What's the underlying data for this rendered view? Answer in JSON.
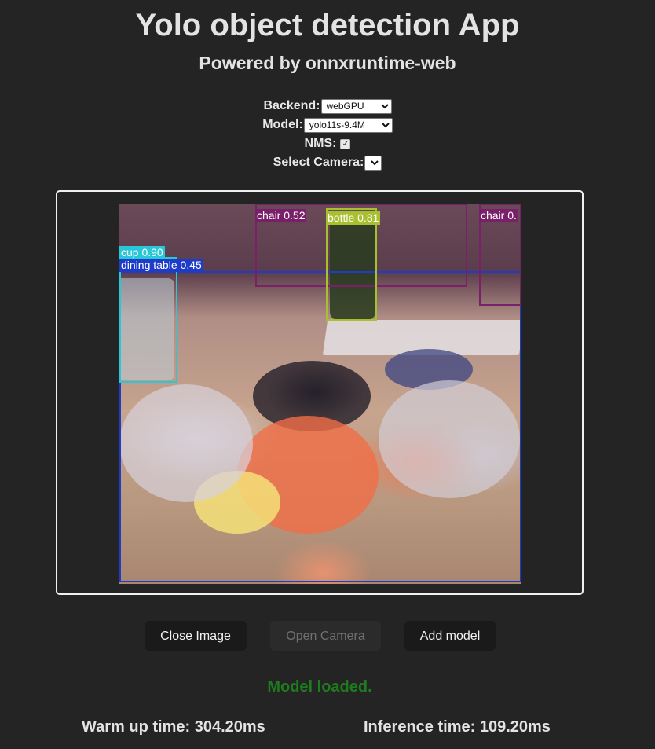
{
  "header": {
    "title": "Yolo object detection App",
    "subtitle": "Powered by onnxruntime-web"
  },
  "controls": {
    "backend_label": "Backend:",
    "backend_value": "webGPU",
    "model_label": "Model:",
    "model_value": "yolo11s-9.4M",
    "nms_label": "NMS:",
    "nms_checked": true,
    "camera_label": "Select Camera:",
    "camera_value": ""
  },
  "detections": [
    {
      "label": "chair 0.52",
      "color": "#7a1f6a"
    },
    {
      "label": "bottle 0.81",
      "color": "#a8c030"
    },
    {
      "label": "chair 0.",
      "color": "#7a1f6a"
    },
    {
      "label": "cup 0.90",
      "color": "#28c8d8"
    },
    {
      "label": "dining table 0.45",
      "color": "#1f3cc8"
    }
  ],
  "buttons": {
    "close_image": "Close Image",
    "open_camera": "Open Camera",
    "add_model": "Add model"
  },
  "status": {
    "message": "Model loaded.",
    "color": "#1e7b1e"
  },
  "timing": {
    "warmup": "Warm up time: 304.20ms",
    "inference": "Inference time: 109.20ms"
  }
}
